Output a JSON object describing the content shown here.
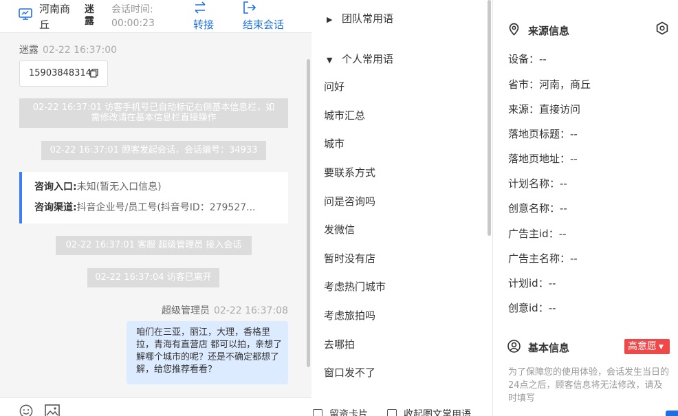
{
  "header": {
    "location": "河南商丘",
    "visitor_name": "迷露",
    "session_time_label": "会话时间:",
    "session_time": "00:00:23",
    "transfer_label": "转接",
    "end_session_label": "结束会话"
  },
  "chat": {
    "visitor_msg": {
      "name": "迷露",
      "time": "02-22 16:37:00",
      "phone": "15903848314"
    },
    "system_1": "02-22 16:37:01 访客手机号已自动标记右侧基本信息栏，如需修改请在基本信息栏直接操作",
    "system_2": "02-22 16:37:01 顾客发起会话，会话编号：34933",
    "consult_entry_key": "咨询入口:",
    "consult_entry_value": "未知(暂无入口信息)",
    "consult_channel_key": "咨询渠道:",
    "consult_channel_value": "抖音企业号/员工号(抖音号ID：279527...",
    "system_3": "02-22 16:37:01 客服 超级管理员 接入会话",
    "system_4": "02-22 16:37:04 访客已离开",
    "agent_msg": {
      "name": "超级管理员",
      "time": "02-22 16:37:08",
      "text": "咱们在三亚，丽江，大理，香格里拉，青海有直营店 都可以拍，亲想了解哪个城市的呢？还是不确定都想了解，给您推荐看看？"
    }
  },
  "phrases": {
    "team_group": "团队常用语",
    "personal_group": "个人常用语",
    "items": [
      "问好",
      "城市汇总",
      "城市",
      "要联系方式",
      "问是咨询吗",
      "发微信",
      "暂时没有店",
      "考虑热门城市",
      "考虑旅拍吗",
      "去哪拍",
      "窗口发不了"
    ],
    "bottom_left": "留资卡片",
    "bottom_right": "收起图文常用语"
  },
  "info": {
    "source_title": "来源信息",
    "fields": [
      "设备：--",
      "省市：河南，商丘",
      "来源：直接访问",
      "落地页标题：--",
      "落地页地址：--",
      "计划名称：--",
      "创意名称：--",
      "广告主id：--",
      "广告主名称：--",
      "计划id：--",
      "创意id：--"
    ],
    "basic_title": "基本信息",
    "intent_tag": "高意愿",
    "note": "为了保障您的使用体验，会话发生当日的24点之后，顾客信息将无法修改，请及时填写"
  },
  "colors": {
    "accent": "#1e6fe5",
    "bubble": "#dcebff",
    "tag_red": "#f04848",
    "system_bg": "#dcdcdc"
  },
  "icons": [
    "monitor-icon",
    "transfer-icon",
    "exit-icon",
    "copy-icon",
    "emoji-icon",
    "image-icon",
    "location-pin-icon",
    "settings-icon",
    "user-circle-icon"
  ]
}
